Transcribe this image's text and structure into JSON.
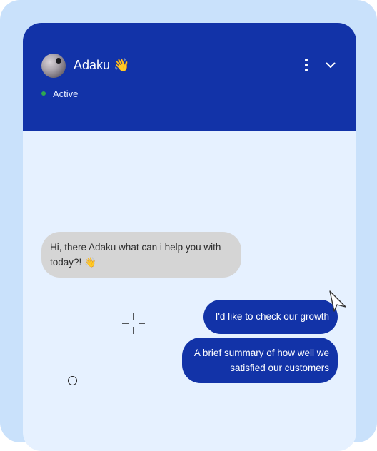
{
  "header": {
    "name": "Adaku",
    "wave_emoji": "👋",
    "status": "Active",
    "status_color": "#2fa84f",
    "menu_icon": "more-vertical-icon",
    "collapse_icon": "chevron-down-icon"
  },
  "messages": [
    {
      "from": "bot",
      "text": "Hi, there Adaku what can i help you with today?! 👋"
    },
    {
      "from": "user",
      "text": "I'd like to check our growth"
    },
    {
      "from": "user",
      "text": "A brief summary of how well we satisfied our customers"
    }
  ],
  "colors": {
    "background": "#c9e1fb",
    "panel": "#e6f1ff",
    "header": "#1233a8",
    "user_bubble": "#1233a8",
    "bot_bubble": "#d5d5d5"
  }
}
